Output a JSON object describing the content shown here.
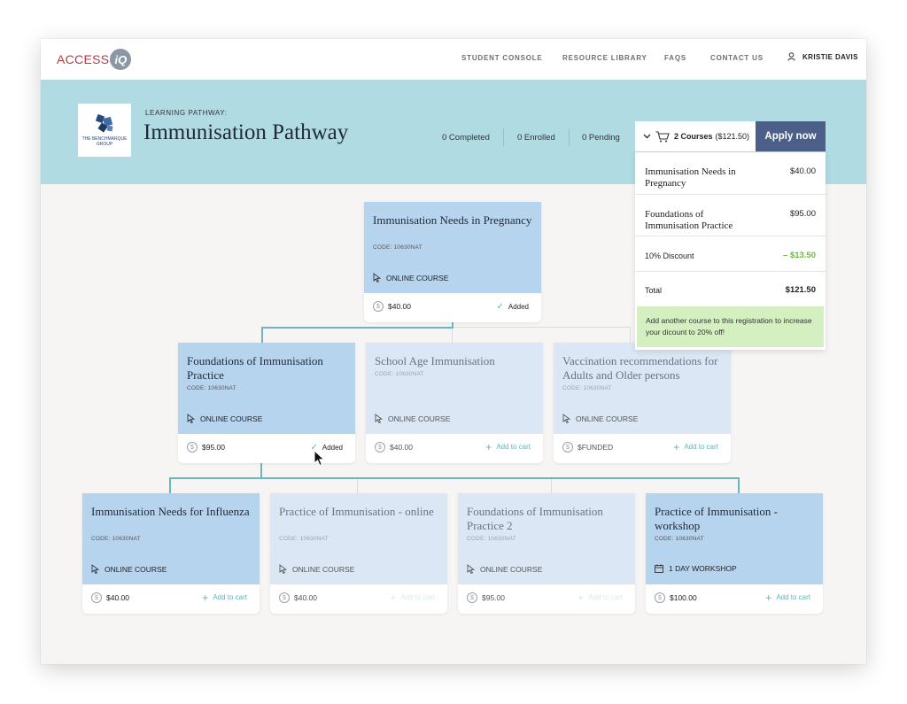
{
  "nav": {
    "logo_text": "ACCESS",
    "logo_badge": "iQ",
    "items": [
      "STUDENT CONSOLE",
      "RESOURCE LIBRARY",
      "FAQS",
      "CONTACT US"
    ],
    "user": "KRISTIE DAVIS"
  },
  "header": {
    "org_logo_text": "THE BENCHMARQUE GROUP",
    "kicker": "LEARNING PATHWAY:",
    "title": "Immunisation Pathway",
    "stats": {
      "completed": "0 Completed",
      "enrolled": "0 Enrolled",
      "pending": "0 Pending"
    },
    "cart_count": "2 Courses",
    "cart_total": "($121.50)",
    "apply": "Apply now"
  },
  "cart_dropdown": {
    "items": [
      {
        "name": "Immunisation Needs in Pregnancy",
        "price": "$40.00"
      },
      {
        "name": "Foundations of Immunisation Practice",
        "price": "$95.00"
      }
    ],
    "discount_label": "10% Discount",
    "discount_value": "– $13.50",
    "total_label": "Total",
    "total_value": "$121.50",
    "promo": "Add another course to this registration to increase your dicount to 20% off!"
  },
  "courses": [
    {
      "title": "Immunisation Needs in Pregnancy",
      "code": "CODE: 10630NAT",
      "type": "ONLINE COURSE",
      "price": "$40.00",
      "action": "Added"
    },
    {
      "title": "Foundations of Immunisation Practice",
      "code": "CODE: 10630NAT",
      "type": "ONLINE COURSE",
      "price": "$95.00",
      "action": "Added"
    },
    {
      "title": "School Age Immunisation",
      "code": "CODE: 10630NAT",
      "type": "ONLINE COURSE",
      "price": "$40.00",
      "action": "Add to cart"
    },
    {
      "title": "Vaccination recommendations for Adults and Older persons",
      "code": "CODE: 10630NAT",
      "type": "ONLINE COURSE",
      "price": "$FUNDED",
      "action": "Add to cart"
    },
    {
      "title": "Immunisation Needs for Influenza",
      "code": "CODE: 10630NAT",
      "type": "ONLINE COURSE",
      "price": "$40.00",
      "action": "Add to cart"
    },
    {
      "title": "Practice of Immunisation - online",
      "code": "CODE: 10630NAT",
      "type": "ONLINE COURSE",
      "price": "$40.00",
      "action": "Add to cart"
    },
    {
      "title": "Foundations of Immunisation Practice 2",
      "code": "CODE: 10630NAT",
      "type": "ONLINE COURSE",
      "price": "$95.00",
      "action": "Add to cart"
    },
    {
      "title": "Practice of Immunisation - workshop",
      "code": "CODE: 10630NAT",
      "type": "1 DAY WORKSHOP",
      "price": "$100.00",
      "action": "Add to cart"
    }
  ],
  "colors": {
    "banner": "#b1dbe2",
    "apply": "#4b5f89",
    "card_active": "#b7d4ef",
    "card_dim": "#dbe7f4",
    "accent": "#5fb5b8",
    "discount": "#6cba3e",
    "promo_bg": "#d5f0c0"
  }
}
